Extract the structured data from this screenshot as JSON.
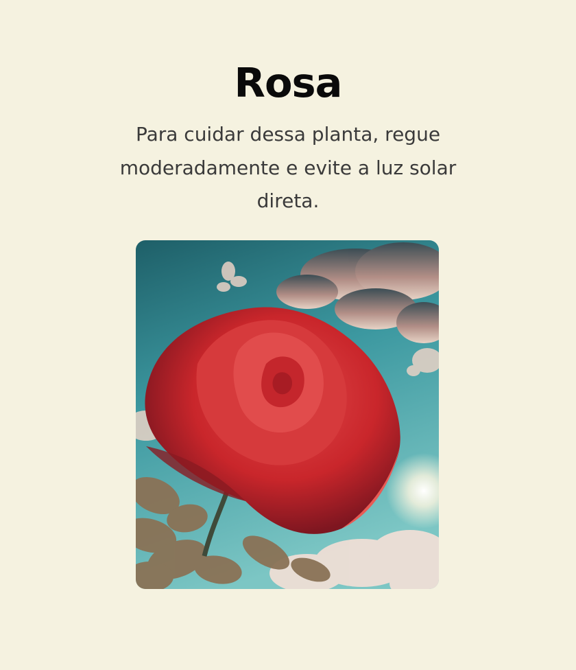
{
  "plant": {
    "name": "Rosa",
    "care_text": "Para cuidar dessa planta, regue moderadamente e evite a luz solar direta."
  },
  "image": {
    "subject": "red rose against blue sky with clouds"
  },
  "colors": {
    "background": "#f5f2e0",
    "title": "#0a0a0a",
    "text": "#3a3a3a",
    "rose": "#d4282c",
    "sky": "#4aa6ad"
  }
}
